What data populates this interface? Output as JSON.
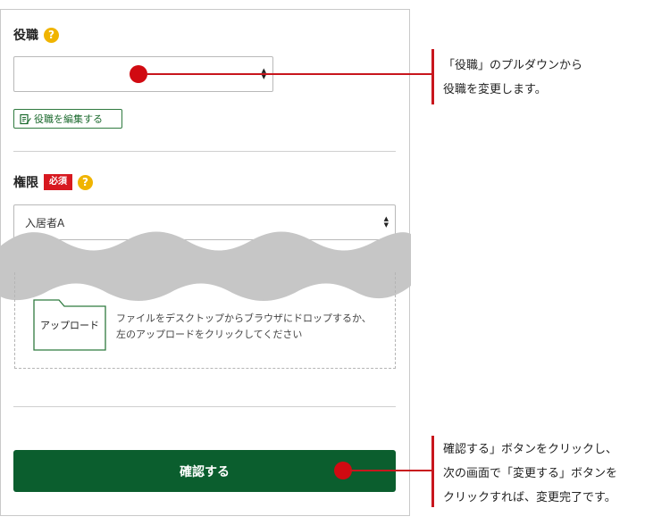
{
  "role": {
    "label": "役職",
    "help": "?",
    "select_value": "",
    "edit_button_label": "役職を編集する"
  },
  "permission": {
    "label": "権限",
    "required_badge": "必須",
    "help": "?",
    "select_value": "入居者A"
  },
  "upload": {
    "folder_label": "アップロード",
    "instructions_line1": "ファイルをデスクトップからブラウザにドロップするか、",
    "instructions_line2": "左のアップロードをクリックしてください"
  },
  "confirm_button_label": "確認する",
  "callouts": {
    "top_line1": "「役職」のプルダウンから",
    "top_line2": "役職を変更します。",
    "bottom_line1": "確認する」ボタンをクリックし、",
    "bottom_line2": "次の画面で「変更する」ボタンを",
    "bottom_line3": "クリックすれば、変更完了です。"
  },
  "colors": {
    "accent_green": "#0b5e2e",
    "required_red": "#d71920",
    "help_yellow": "#f0b400",
    "annotation_red": "#c8161d"
  }
}
